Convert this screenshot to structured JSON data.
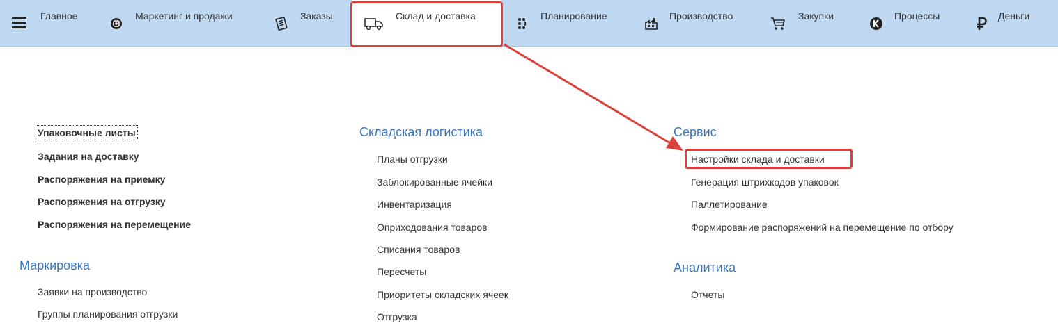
{
  "sections": [
    {
      "label": "Главное",
      "icon": "menu-icon"
    },
    {
      "label": "Маркетинг и продажи",
      "icon": "marketing-icon"
    },
    {
      "label": "Заказы",
      "icon": "orders-icon"
    },
    {
      "label": "Склад и доставка",
      "icon": "truck-icon"
    },
    {
      "label": "Планирование",
      "icon": "planning-icon"
    },
    {
      "label": "Производство",
      "icon": "factory-icon"
    },
    {
      "label": "Закупки",
      "icon": "cart-icon"
    },
    {
      "label": "Процессы",
      "icon": "processes-icon"
    },
    {
      "label": "Деньги",
      "icon": "ruble-icon"
    }
  ],
  "active_section": "Склад и доставка",
  "col1": {
    "links": [
      "Упаковочные листы",
      "Задания на доставку",
      "Распоряжения на приемку",
      "Распоряжения на отгрузку",
      "Распоряжения на перемещение"
    ],
    "group2": {
      "title": "Маркировка",
      "links": [
        "Заявки на производство",
        "Группы планирования отгрузки"
      ]
    }
  },
  "col2": {
    "title": "Складская логистика",
    "links": [
      "Планы отгрузки",
      "Заблокированные ячейки",
      "Инвентаризация",
      "Оприходования товаров",
      "Списания товаров",
      "Пересчеты",
      "Приоритеты складских ячеек",
      "Отгрузка"
    ]
  },
  "col3": {
    "group1": {
      "title": "Сервис",
      "links": [
        "Настройки склада и доставки",
        "Генерация штрихкодов упаковок",
        "Паллетирование",
        "Формирование распоряжений на перемещение по отбору"
      ]
    },
    "group2": {
      "title": "Аналитика",
      "links": [
        "Отчеты"
      ]
    }
  },
  "colors": {
    "topbar": "#bed9f1",
    "group_title": "#3a78c2",
    "annotation": "#d9423a"
  }
}
